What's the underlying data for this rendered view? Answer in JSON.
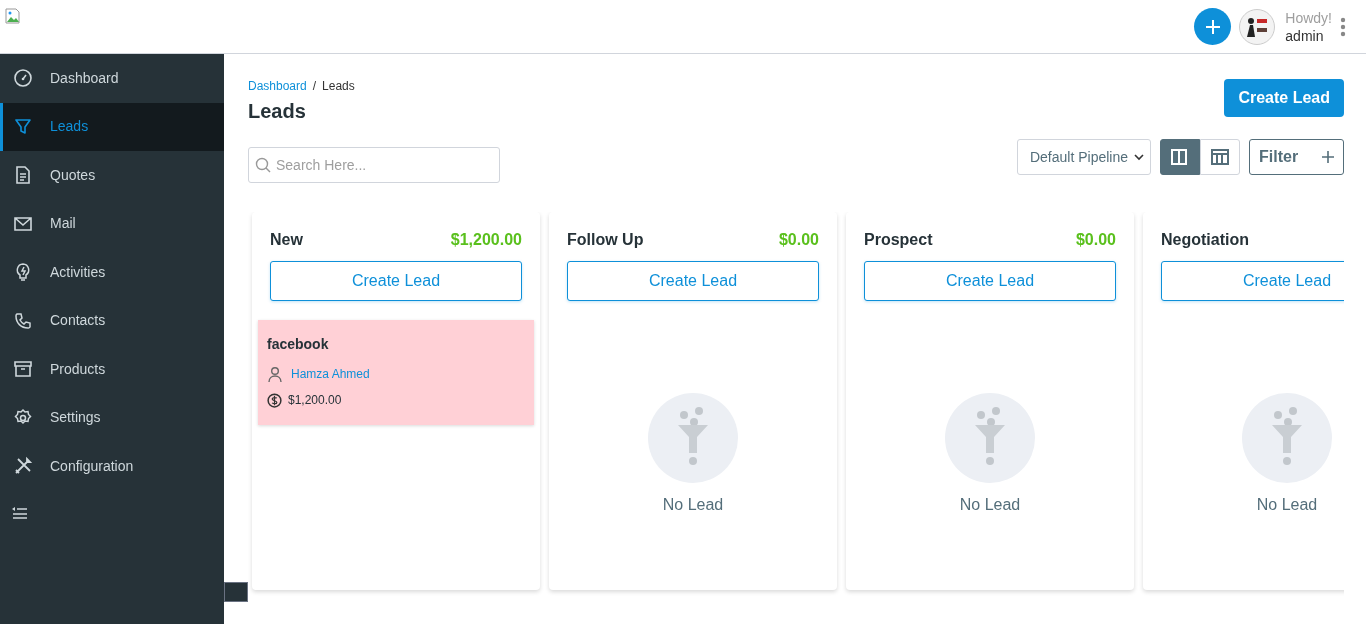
{
  "header": {
    "user": {
      "greeting": "Howdy!",
      "name": "admin"
    }
  },
  "sidebar": {
    "items": [
      {
        "label": "Dashboard",
        "selected": false
      },
      {
        "label": "Leads",
        "selected": true
      },
      {
        "label": "Quotes",
        "selected": false
      },
      {
        "label": "Mail",
        "selected": false
      },
      {
        "label": "Activities",
        "selected": false
      },
      {
        "label": "Contacts",
        "selected": false
      },
      {
        "label": "Products",
        "selected": false
      },
      {
        "label": "Settings",
        "selected": false
      },
      {
        "label": "Configuration",
        "selected": false
      }
    ]
  },
  "breadcrumb": [
    "Dashboard",
    "/",
    "Leads"
  ],
  "page_title": "Leads",
  "create_button": "Create Lead",
  "search": {
    "placeholder": "Search Here..."
  },
  "pipeline_select": {
    "value": "Default Pipeline"
  },
  "view_toggle": [
    {
      "selected": true
    },
    {
      "selected": false
    }
  ],
  "filter_button": "Filter",
  "stages": [
    {
      "name": "New",
      "total": "$1,200.00",
      "button": "Create Lead",
      "leads": [
        {
          "title": "facebook",
          "person": "Hamza Ahmed",
          "amount": "$1,200.00"
        }
      ]
    },
    {
      "name": "Follow Up",
      "total": "$0.00",
      "button": "Create Lead",
      "empty_text": "No Lead"
    },
    {
      "name": "Prospect",
      "total": "$0.00",
      "button": "Create Lead",
      "empty_text": "No Lead"
    },
    {
      "name": "Negotiation",
      "button": "Create Lead",
      "empty_text": "No Lead"
    }
  ]
}
